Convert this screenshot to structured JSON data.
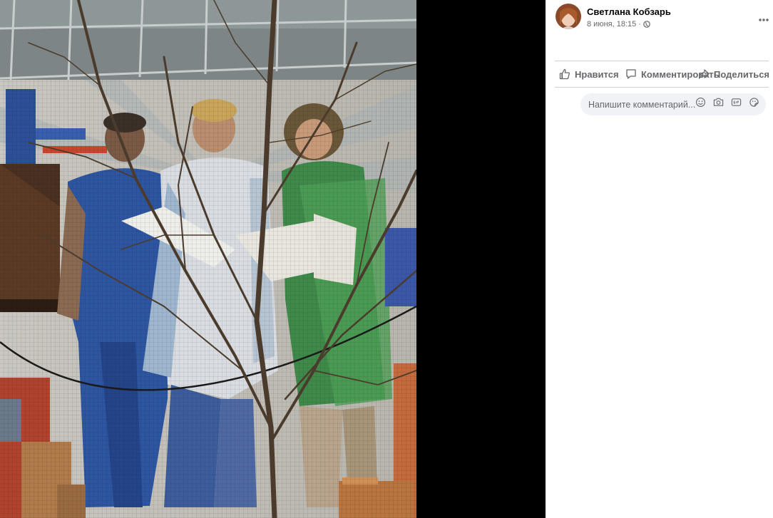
{
  "post": {
    "author": "Светлана Кобзарь",
    "date": "8 июня, 18:15",
    "separator": "·",
    "privacy_icon": "globe-icon"
  },
  "actions": {
    "like_label": "Нравится",
    "comment_label": "Комментировать",
    "share_label": "Поделиться"
  },
  "comment_input": {
    "placeholder": "Напишите комментарий..."
  },
  "icons": {
    "more": "more-horizontal-icon",
    "like": "thumbs-up-icon",
    "comment": "speech-bubble-icon",
    "share": "share-arrow-icon",
    "emoji": "smiley-icon",
    "camera": "camera-icon",
    "gif": "gif-icon",
    "sticker": "sticker-icon"
  },
  "colors": {
    "theater_bg": "#000000",
    "panel_bg": "#ffffff",
    "secondary_text": "#65676b",
    "input_bg": "#f0f2f5"
  }
}
